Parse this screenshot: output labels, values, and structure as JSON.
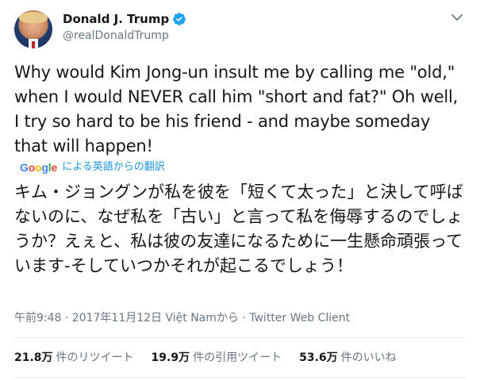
{
  "user": {
    "display_name": "Donald J. Trump",
    "handle": "@realDonaldTrump",
    "verified": true
  },
  "tweet": {
    "text": "Why would Kim Jong-un insult me by calling me \"old,\" when I would NEVER call him \"short and fat?\" Oh well, I try so hard to be his friend - and maybe someday that will happen!",
    "translation_provider": "Google",
    "translation_label": "による英語からの翻訳",
    "translated_text": "キム・ジョングンが私を彼を「短くて太った」と決して呼ばないのに、なぜ私を「古い」と言って私を侮辱するのでしょうか？えぇと、私は彼の友達になるために一生懸命頑張っています-そしていつかそれが起こるでしょう！",
    "meta": "午前9:48 · 2017年11月12日 Việt Namから · Twitter Web Client"
  },
  "stats": {
    "retweets_count": "21.8万",
    "retweets_label": "件のリツイート",
    "quotes_count": "19.9万",
    "quotes_label": "件の引用ツイート",
    "likes_count": "53.6万",
    "likes_label": "件のいいね"
  },
  "colors": {
    "verified_blue": "#1da1f2",
    "link_blue": "#1b95e0",
    "secondary_text": "#657786"
  },
  "icons": {
    "verified": "verified-badge-icon",
    "caret": "chevron-down-icon"
  }
}
